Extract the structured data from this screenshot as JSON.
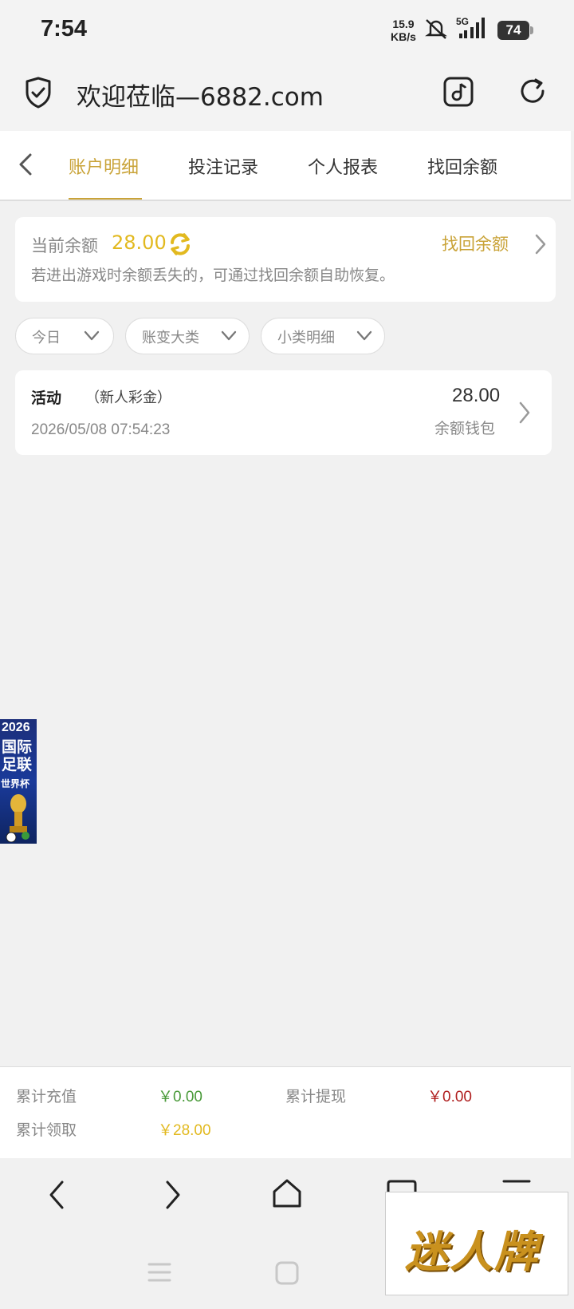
{
  "status_bar": {
    "time": "7:54",
    "net_speed_value": "15.9",
    "net_speed_unit": "KB/s",
    "network": "5G",
    "battery": "74"
  },
  "url_bar": {
    "title": "欢迎莅临—6882.com"
  },
  "tabs": [
    {
      "label": "账户明细",
      "active": true
    },
    {
      "label": "投注记录",
      "active": false
    },
    {
      "label": "个人报表",
      "active": false
    },
    {
      "label": "找回余额",
      "active": false
    }
  ],
  "balance_card": {
    "label": "当前余额",
    "value": "28.00",
    "recover_link": "找回余额",
    "hint": "若进出游戏时余额丢失的，可通过找回余额自助恢复。"
  },
  "filters": [
    {
      "label": "今日"
    },
    {
      "label": "账变大类"
    },
    {
      "label": "小类明细"
    }
  ],
  "records": [
    {
      "title": "活动",
      "subtitle": "（新人彩金）",
      "time": "2026/05/08 07:54:23",
      "amount": "28.00",
      "wallet": "余额钱包"
    }
  ],
  "float_banner": {
    "year": "2026",
    "title": "国际足联",
    "subtitle": "世界杯"
  },
  "summary": {
    "recharge_label": "累计充值",
    "recharge_value": "￥0.00",
    "withdraw_label": "累计提现",
    "withdraw_value": "￥0.00",
    "claimed_label": "累计领取",
    "claimed_value": "￥28.00"
  },
  "watermark": {
    "text": "迷人牌"
  },
  "colors": {
    "accent": "#c9a338",
    "balance": "#e2b91f",
    "positive": "#4a9a3a",
    "negative": "#b02020"
  },
  "icons": [
    "shield-check-icon",
    "music-note-icon",
    "reload-icon",
    "back-chevron-icon",
    "refresh-icon",
    "chevron-right-icon",
    "chevron-down-icon",
    "nav-back-icon",
    "nav-forward-icon",
    "home-icon",
    "tabs-icon",
    "menu-icon",
    "mute-icon",
    "signal-icon"
  ]
}
